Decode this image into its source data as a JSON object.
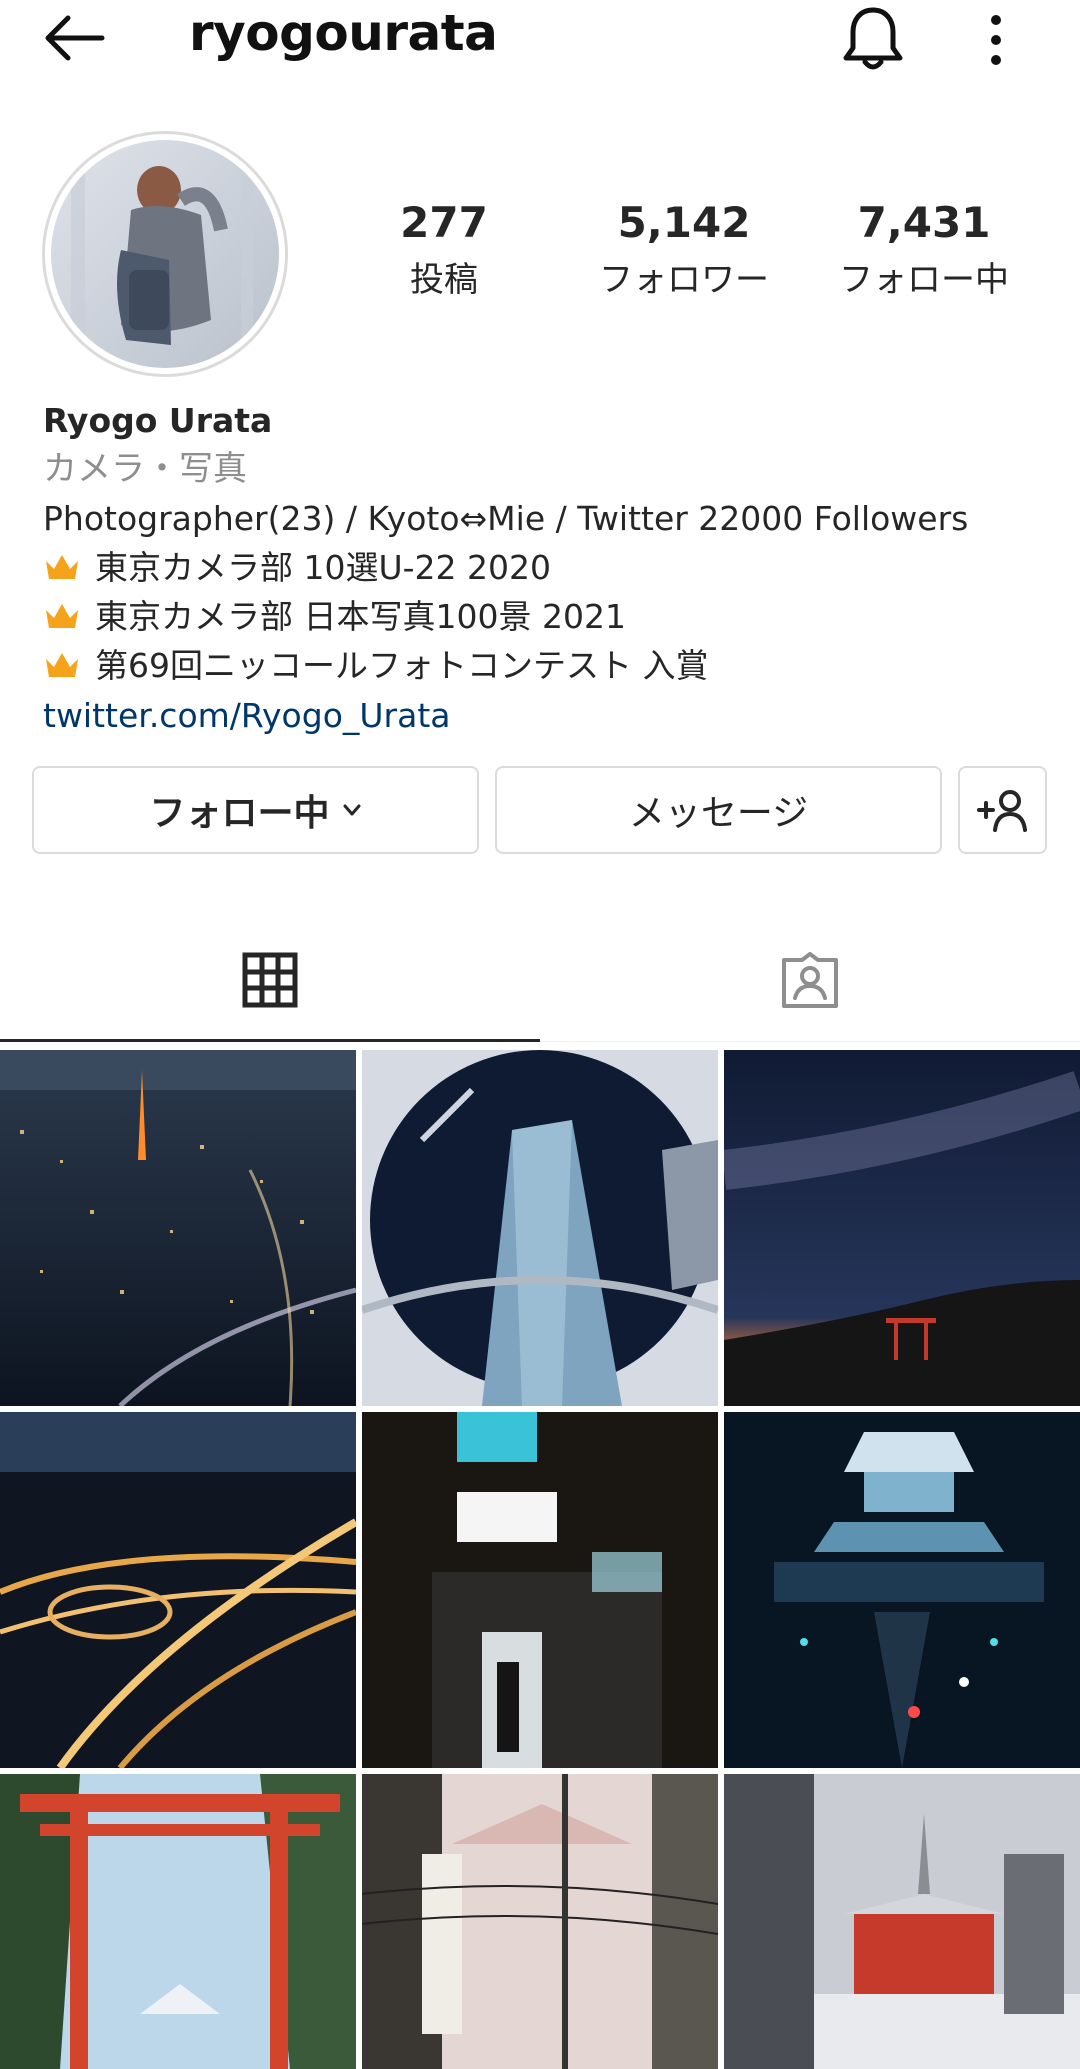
{
  "header": {
    "username": "ryogourata",
    "back_icon": "arrow-left-icon",
    "notifications_icon": "bell-icon",
    "more_icon": "more-vertical-icon"
  },
  "profile": {
    "stats": [
      {
        "value": "277",
        "label": "投稿"
      },
      {
        "value": "5,142",
        "label": "フォロワー"
      },
      {
        "value": "7,431",
        "label": "フォロー中"
      }
    ],
    "name": "Ryogo Urata",
    "category": "カメラ・写真",
    "bio_lines": [
      "Photographer(23) / Kyoto⇔Mie / Twitter 22000 Followers",
      "東京カメラ部 10選U-22 2020",
      "東京カメラ部 日本写真100景 2021",
      "第69回ニッコールフォトコンテスト 入賞"
    ],
    "link": "twitter.com/Ryogo_Urata"
  },
  "actions": {
    "following_label": "フォロー中",
    "message_label": "メッセージ",
    "add_user_icon": "add-user-icon"
  },
  "tabs": {
    "grid_icon": "grid-icon",
    "tagged_icon": "tagged-icon"
  },
  "colors": {
    "link": "#00376b",
    "secondary_text": "#8e8e8e",
    "border": "#dbdbdb",
    "crown": "#f5a31a"
  }
}
